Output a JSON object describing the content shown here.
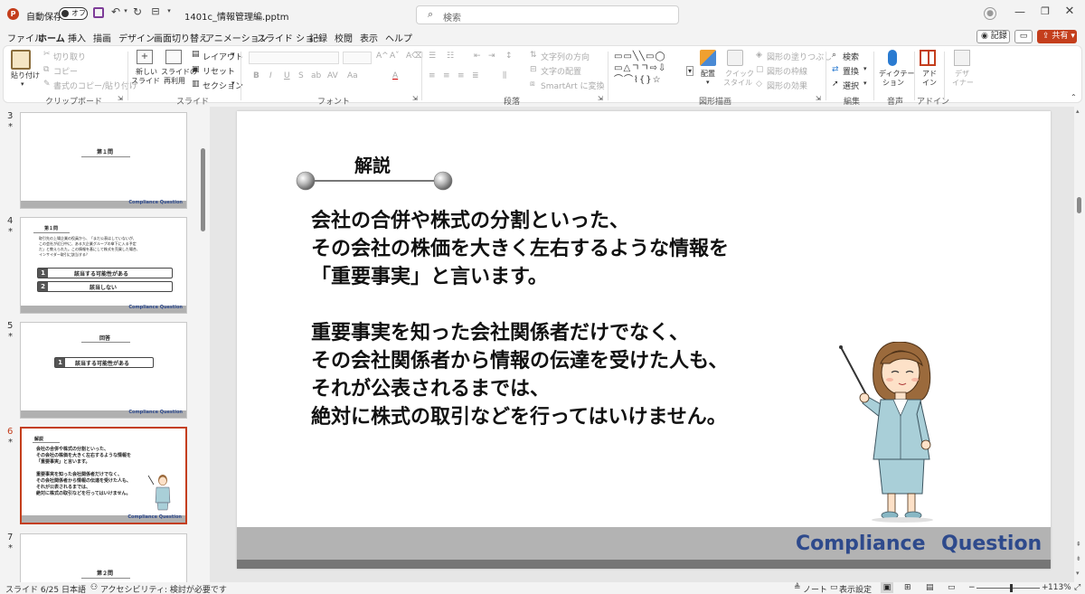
{
  "titlebar": {
    "autosave_label": "自動保存",
    "toggle_state": "オフ",
    "filename": "1401c_情報管理編.pptm",
    "search_placeholder": "検索"
  },
  "menu": [
    "ファイル",
    "ホーム",
    "挿入",
    "描画",
    "デザイン",
    "画面切り替え",
    "アニメーション",
    "スライド ショー",
    "記録",
    "校閲",
    "表示",
    "ヘルプ"
  ],
  "menu_right": {
    "record_label": "記録",
    "share_label": "共有"
  },
  "ribbon": {
    "clipboard": {
      "paste": "貼り付け",
      "cut": "切り取り",
      "copy": "コピー",
      "format_painter": "書式のコピー/貼り付け",
      "label": "クリップボード"
    },
    "slides": {
      "new_slide_1": "新しい",
      "new_slide_2": "スライド",
      "reuse_1": "スライドの",
      "reuse_2": "再利用",
      "layout": "レイアウト",
      "reset": "リセット",
      "section": "セクション",
      "label": "スライド"
    },
    "font": {
      "bold": "B",
      "italic": "I",
      "underline": "U",
      "strike": "S",
      "shadow": "ab",
      "spacing": "AV",
      "case": "Aa",
      "label": "フォント"
    },
    "paragraph": {
      "text_direction": "文字列の方向",
      "align_text": "文字の配置",
      "smartart": "SmartArt に変換",
      "label": "段落"
    },
    "drawing": {
      "arrange": "配置",
      "quick_1": "クイック",
      "quick_2": "スタイル",
      "fill": "図形の塗りつぶし",
      "outline": "図形の枠線",
      "effects": "図形の効果",
      "label": "図形描画"
    },
    "editing": {
      "find": "検索",
      "replace": "置換",
      "select": "選択",
      "label": "編集"
    },
    "voice": {
      "dictate_1": "ディクテー",
      "dictate_2": "ション",
      "label": "音声"
    },
    "addins": {
      "addin_1": "アド",
      "addin_2": "イン",
      "label": "アドイン"
    },
    "designer": {
      "designer_1": "デザ",
      "designer_2": "イナー"
    }
  },
  "thumbnails": [
    {
      "num": "3",
      "star": "*",
      "title": "第１問",
      "footer": "Compliance Question"
    },
    {
      "num": "4",
      "star": "*",
      "header": "第１問",
      "question_1": "取引先の上場企業の役員から、「まだ公表はしていないが、",
      "question_2": "この会社が近日中に、ある大企業グループの傘下に入る予定",
      "question_3": "だ」と教えられた。この情報を基にして株式を売買した場合、",
      "question_4": "インサイダー取引に該当する？",
      "option1_num": "1",
      "option1": "該当する可能性がある",
      "option2_num": "2",
      "option2": "該当しない",
      "footer": "Compliance Question"
    },
    {
      "num": "5",
      "star": "*",
      "title": "回答",
      "answer_num": "1",
      "answer": "該当する可能性がある",
      "footer": "Compliance Question"
    },
    {
      "num": "6",
      "star": "*",
      "title": "解説",
      "l1": "会社の合併や株式の分割といった、",
      "l2": "その会社の株価を大きく左右するような情報を",
      "l3": "「重要事実」と言います。",
      "l4": "重要事実を知った会社関係者だけでなく、",
      "l5": "その会社関係者から情報の伝達を受けた人も、",
      "l6": "それが公表されるまでは、",
      "l7": "絶対に株式の取引などを行ってはいけません。",
      "footer": "Compliance Question"
    },
    {
      "num": "7",
      "star": "*",
      "title": "第２問"
    }
  ],
  "slide": {
    "heading": "解説",
    "line1": "会社の合併や株式の分割といった、",
    "line2": "その会社の株価を大きく左右するような情報を",
    "line3": "「重要事実」と言います。",
    "line4": "重要事実を知った会社関係者だけでなく、",
    "line5": "その会社関係者から情報の伝達を受けた人も、",
    "line6": "それが公表されるまでは、",
    "line7": "絶対に株式の取引などを行ってはいけません。",
    "footer_1": "Compliance",
    "footer_2": "Question"
  },
  "status": {
    "slide_count": "スライド 6/25",
    "language": "日本語",
    "accessibility": "アクセシビリティ: 検討が必要です",
    "notes": "ノート",
    "display_settings": "表示設定",
    "zoom": "113%"
  },
  "colors": {
    "accent": "#c43e1c",
    "footer_text": "#2e4a8c",
    "footer_band": "#b3b3b3",
    "footer_bar": "#767676"
  }
}
